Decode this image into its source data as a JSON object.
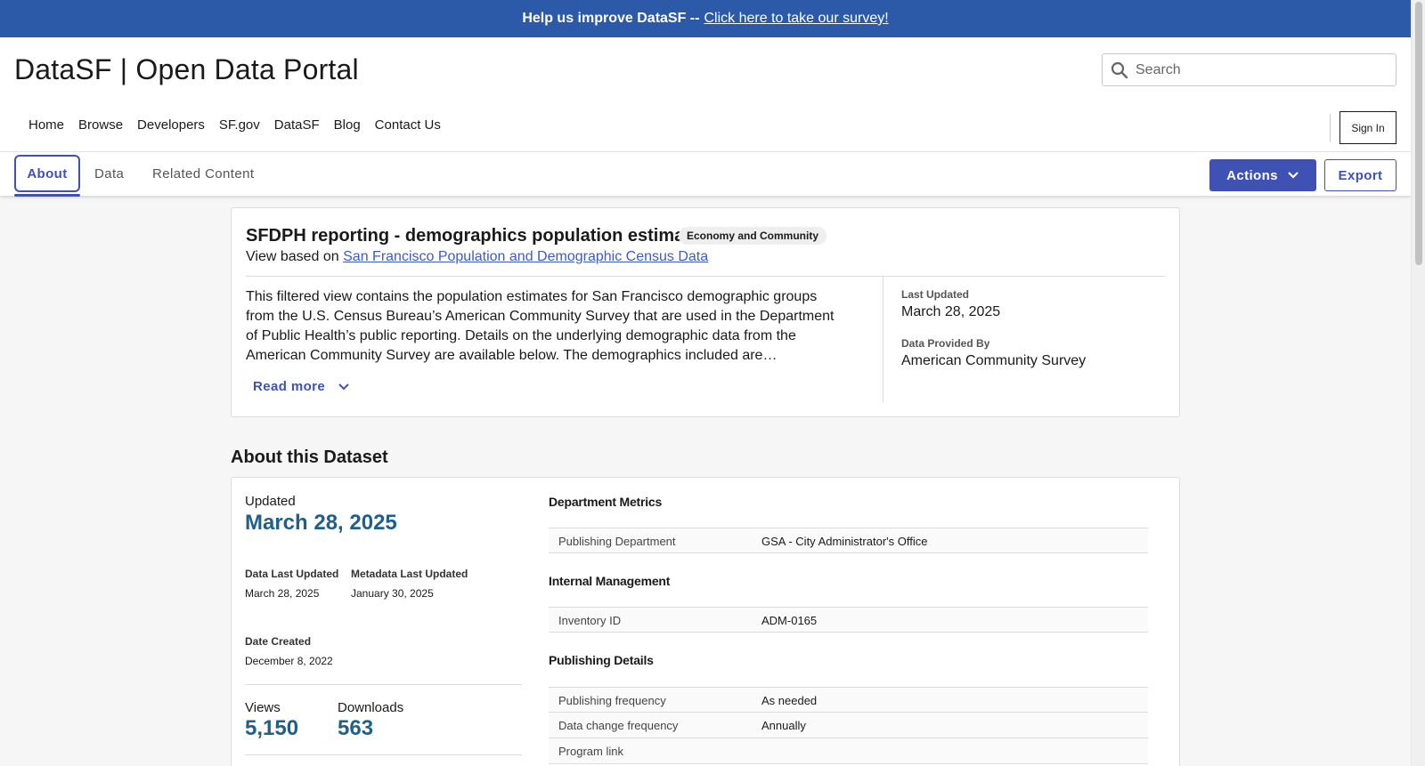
{
  "banner": {
    "text": "Help us improve DataSF --",
    "link": "Click here to take our survey!"
  },
  "header": {
    "site_title": "DataSF | Open Data Portal",
    "search_placeholder": "Search",
    "sign_in": "Sign In",
    "nav": [
      "Home",
      "Browse",
      "Developers",
      "SF.gov",
      "DataSF",
      "Blog",
      "Contact Us"
    ]
  },
  "tabs": {
    "items": [
      "About",
      "Data",
      "Related Content"
    ],
    "active": "About",
    "actions_label": "Actions",
    "export_label": "Export"
  },
  "summary": {
    "title": "SFDPH reporting - demographics population estimates",
    "category_badge": "Economy and Community",
    "based_on_prefix": "View based on",
    "based_on_link": "San Francisco Population and Demographic Census Data",
    "description": "This filtered view contains the population estimates for San Francisco demographic groups from the U.S. Census Bureau’s American Community Survey that are used in the Department of Public Health’s public reporting. Details on the underlying demographic data from the American Community Survey are available below. The demographics included are…",
    "read_more": "Read more",
    "last_updated_label": "Last Updated",
    "last_updated_value": "March 28, 2025",
    "provided_by_label": "Data Provided By",
    "provided_by_value": "American Community Survey"
  },
  "about": {
    "heading": "About this Dataset",
    "updated_label": "Updated",
    "updated_value": "March 28, 2025",
    "data_last_updated_label": "Data Last Updated",
    "data_last_updated_value": "March 28, 2025",
    "metadata_last_updated_label": "Metadata Last Updated",
    "metadata_last_updated_value": "January 30, 2025",
    "date_created_label": "Date Created",
    "date_created_value": "December 8, 2022",
    "views_label": "Views",
    "views_value": "5,150",
    "downloads_label": "Downloads",
    "downloads_value": "563",
    "groups": {
      "department_metrics": {
        "title": "Department Metrics",
        "rows": [
          {
            "key": "Publishing Department",
            "value": "GSA - City Administrator's Office"
          }
        ]
      },
      "internal_management": {
        "title": "Internal Management",
        "rows": [
          {
            "key": "Inventory ID",
            "value": "ADM-0165"
          }
        ]
      },
      "publishing_details": {
        "title": "Publishing Details",
        "rows": [
          {
            "key": "Publishing frequency",
            "value": "As needed"
          },
          {
            "key": "Data change frequency",
            "value": "Annually"
          },
          {
            "key": "Program link",
            "value": ""
          }
        ]
      }
    }
  },
  "colors": {
    "banner": "#2c5aa8",
    "accent": "#3f51b5",
    "stat": "#1f5f8b",
    "link": "#3c5cc6"
  }
}
